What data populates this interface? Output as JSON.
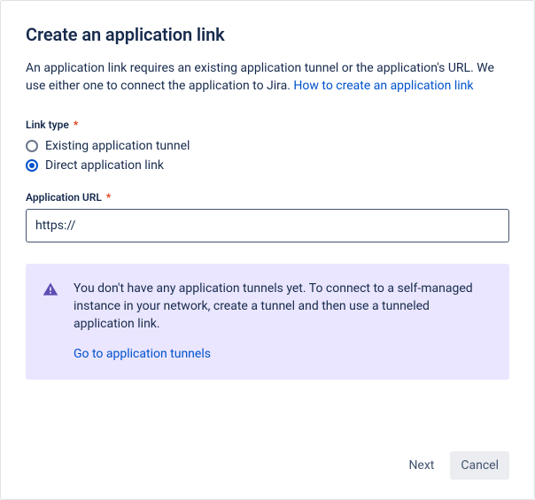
{
  "modal": {
    "title": "Create an application link",
    "description_pre": "An application link requires an existing application tunnel or the application's URL. We use either one to connect the application to Jira. ",
    "description_link": "How to create an application link"
  },
  "link_type": {
    "label": "Link type",
    "required_marker": "*",
    "options": [
      {
        "label": "Existing application tunnel",
        "selected": false
      },
      {
        "label": "Direct application link",
        "selected": true
      }
    ]
  },
  "app_url": {
    "label": "Application URL",
    "required_marker": "*",
    "value": "https://"
  },
  "info": {
    "icon": "warning-icon",
    "text": "You don't have any application tunnels yet. To connect to a self-managed instance in your network, create a tunnel and then use a tunneled application link.",
    "link_label": "Go to application tunnels"
  },
  "footer": {
    "next": "Next",
    "cancel": "Cancel"
  }
}
